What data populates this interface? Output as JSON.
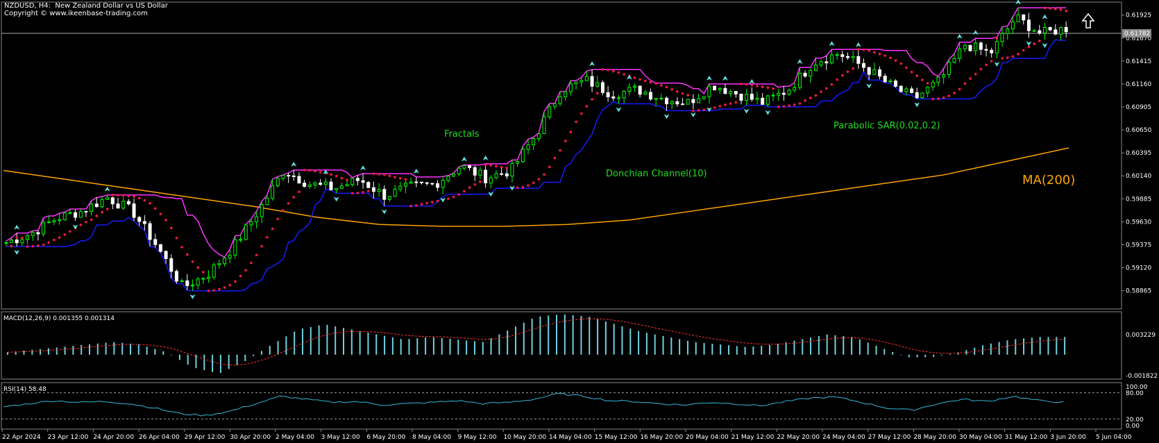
{
  "header": {
    "title": "NZDUSD, H4:  New Zealand Dollar vs US Dollar",
    "copyright": "Copyright © www.ikeenbase-trading.com"
  },
  "current_price": "0.61782",
  "price_axis": [
    "0.61925",
    "0.61670",
    "0.61415",
    "0.61160",
    "0.60905",
    "0.60650",
    "0.60395",
    "0.60140",
    "0.59885",
    "0.59630",
    "0.59375",
    "0.59120",
    "0.58865"
  ],
  "time_axis": [
    "22 Apr 2024",
    "23 Apr 12:00",
    "24 Apr 20:00",
    "26 Apr 04:00",
    "29 Apr 12:00",
    "30 Apr 20:00",
    "2 May 04:00",
    "3 May 12:00",
    "6 May 20:00",
    "8 May 04:00",
    "9 May 12:00",
    "10 May 20:00",
    "14 May 04:00",
    "15 May 12:00",
    "16 May 20:00",
    "20 May 04:00",
    "21 May 12:00",
    "22 May 20:00",
    "24 May 04:00",
    "27 May 12:00",
    "28 May 20:00",
    "30 May 04:00",
    "31 May 12:00",
    "3 Jun 20:00",
    "5 Jun 04:00"
  ],
  "annotations": {
    "fractals": "Fractals",
    "donchian": "Donchian Channel(10)",
    "sar": "Parabolic SAR(0.02,0.2)",
    "ma": "MA(200)"
  },
  "macd": {
    "label": "MACD(12,26,9) 0.001355 0.001314",
    "axis_top": "0.003229",
    "axis_bottom": "-0.001822"
  },
  "rsi": {
    "label": "RSI(14) 58.48",
    "axis": [
      "100.00",
      "80.00",
      "20.00",
      "0.00"
    ]
  },
  "colors": {
    "bull_candle": "#00ff00",
    "bear_candle": "#ffffff",
    "donchian_upper": "#ff33ff",
    "donchian_lower": "#1a1aff",
    "sar": "#ff1a3c",
    "ma200": "#ffa500",
    "macd_hist": "#6fd3e0",
    "macd_signal": "#ff3333",
    "rsi_line": "#38b6d8",
    "fractal": "#5fe0e0"
  },
  "chart_data": [
    {
      "type": "line",
      "title": "NZDUSD, H4",
      "ylim": [
        0.587,
        0.62
      ],
      "last_value": 0.61782,
      "series": [
        {
          "values": [
            0.594,
            0.595,
            0.5967,
            0.5975,
            0.599,
            0.5975,
            0.5935,
            0.589,
            0.5905,
            0.5935,
            0.5975,
            0.602,
            0.6005,
            0.6,
            0.601,
            0.5992,
            0.6002,
            0.6005,
            0.6025,
            0.6012,
            0.602,
            0.606,
            0.611,
            0.612,
            0.6105,
            0.611,
            0.61,
            0.6095,
            0.6115,
            0.6105,
            0.6095,
            0.611,
            0.614,
            0.615,
            0.6135,
            0.6115,
            0.61,
            0.612,
            0.616,
            0.615,
            0.619,
            0.6172,
            0.6178
          ]
        },
        {
          "name": "MA(200)",
          "values": [
            0.602,
            0.601,
            0.6,
            0.599,
            0.598,
            0.5968,
            0.596,
            0.5958,
            0.5958,
            0.596,
            0.5965,
            0.5975,
            0.5985,
            0.5995,
            0.6005,
            0.6015,
            0.603,
            0.6045
          ]
        },
        {
          "name": "Donchian Channel(10)",
          "values": []
        },
        {
          "name": "Parabolic SAR(0.02,0.2)",
          "values": []
        }
      ]
    },
    {
      "type": "bar",
      "title": "MACD(12,26,9)",
      "ylim": [
        -0.001822,
        0.003229
      ],
      "last_value": 0.001355,
      "signal_last": 0.001314,
      "series": [
        {
          "values": [
            0.0002,
            0.0004,
            0.0006,
            0.0008,
            0.001,
            0.0008,
            0.0002,
            -0.001,
            -0.0015,
            -0.0005,
            0.0008,
            0.002,
            0.0024,
            0.002,
            0.0016,
            0.0012,
            0.0014,
            0.0012,
            0.001,
            0.002,
            0.003,
            0.0032,
            0.003,
            0.0024,
            0.0018,
            0.0014,
            0.001,
            0.0008,
            0.0006,
            0.0008,
            0.0012,
            0.0016,
            0.0014,
            0.0006,
            -0.0002,
            -0.0002,
            0.0002,
            0.0008,
            0.0012,
            0.0014,
            0.0014
          ]
        }
      ]
    },
    {
      "type": "line",
      "title": "RSI(14)",
      "ylim": [
        0,
        100
      ],
      "last_value": 58.48,
      "series": [
        {
          "values": [
            48,
            55,
            62,
            58,
            60,
            55,
            45,
            32,
            28,
            38,
            55,
            72,
            65,
            58,
            60,
            52,
            55,
            58,
            62,
            55,
            58,
            65,
            78,
            72,
            62,
            60,
            55,
            52,
            58,
            55,
            50,
            60,
            68,
            70,
            58,
            45,
            40,
            55,
            65,
            60,
            72,
            62,
            58.48
          ]
        }
      ]
    }
  ]
}
